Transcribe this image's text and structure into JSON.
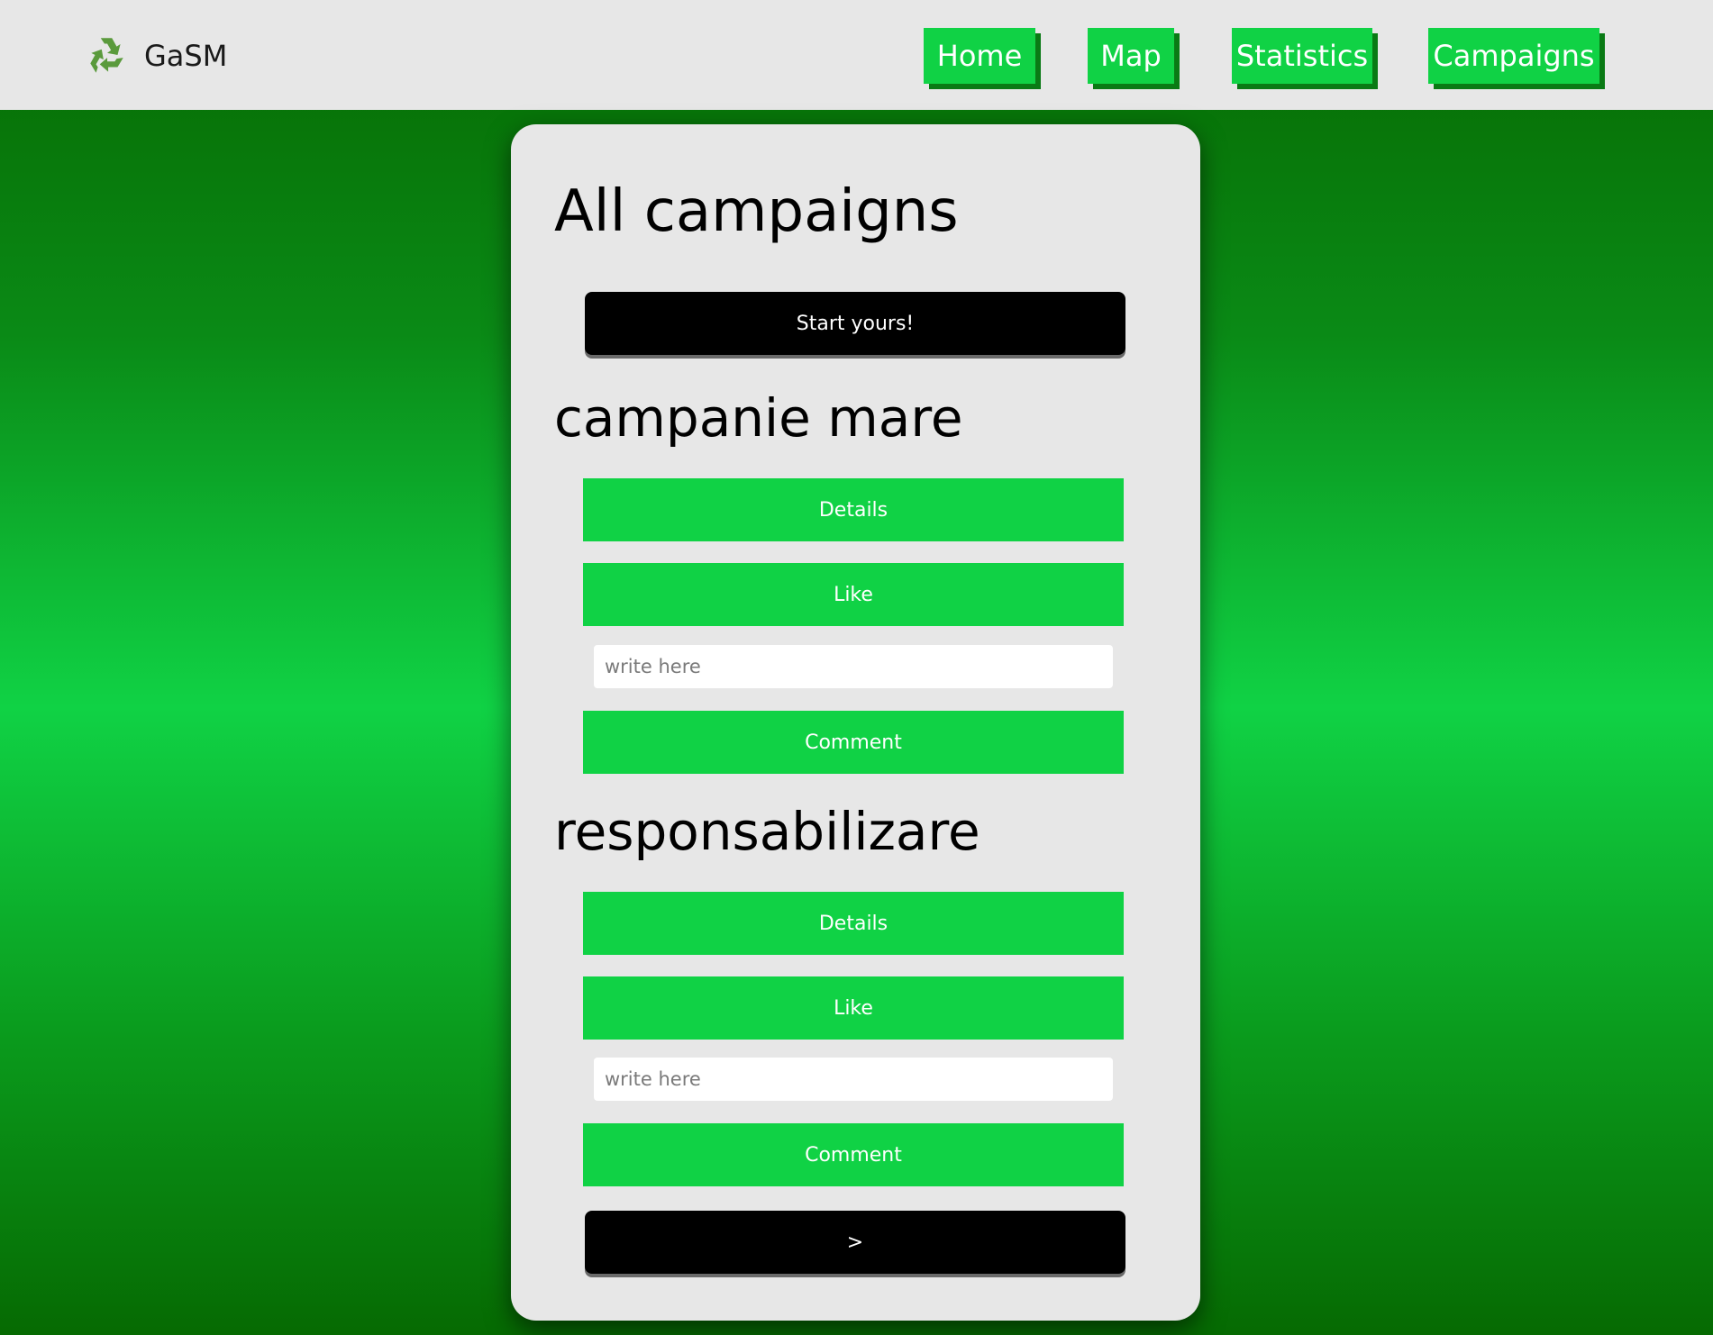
{
  "brand": {
    "name": "GaSM",
    "logo_icon": "recycle-icon",
    "logo_color": "#5a9a3c"
  },
  "nav": {
    "items": [
      {
        "label": "Home"
      },
      {
        "label": "Map"
      },
      {
        "label": "Statistics"
      },
      {
        "label": "Campaigns"
      }
    ]
  },
  "colors": {
    "accent_green": "#10d245",
    "topbar_bg": "#e7e7e7",
    "card_bg": "#e7e7e7",
    "button_dark": "#000000"
  },
  "main": {
    "title": "All campaigns",
    "start_button": "Start yours!",
    "next_button": ">",
    "campaigns": [
      {
        "name": "campanie mare",
        "details_label": "Details",
        "like_label": "Like",
        "comment_placeholder": "write here",
        "comment_label": "Comment"
      },
      {
        "name": "responsabilizare",
        "details_label": "Details",
        "like_label": "Like",
        "comment_placeholder": "write here",
        "comment_label": "Comment"
      }
    ]
  }
}
